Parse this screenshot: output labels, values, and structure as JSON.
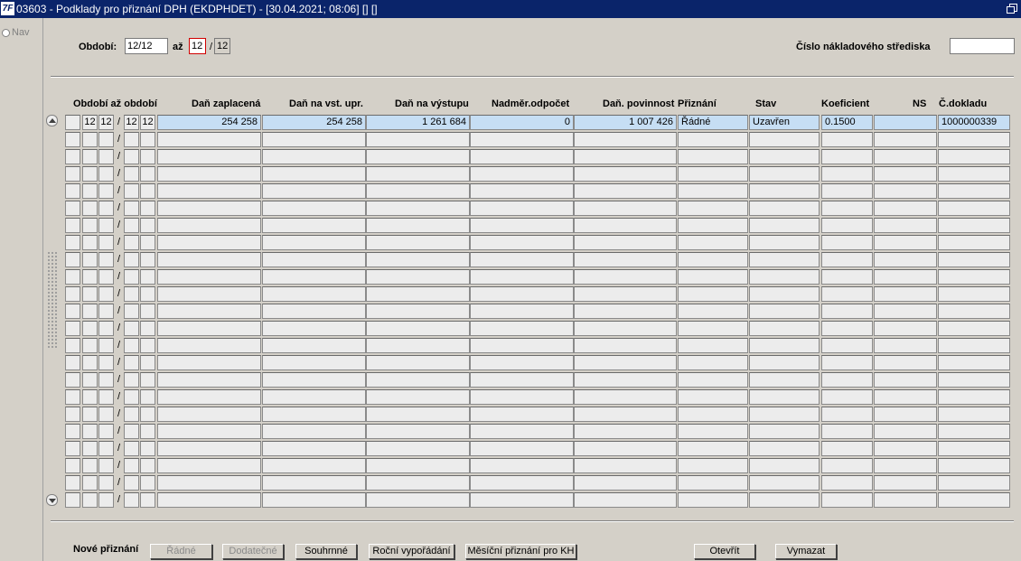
{
  "window": {
    "app_icon_text": "7F",
    "title": "03603 - Podklady pro přiznání DPH (EKDPHDET) - [30.04.2021; 08:06]  [] []"
  },
  "nav": {
    "label": "Nav"
  },
  "filters": {
    "obdobi_label": "Období:",
    "obdobi_from": "12/12",
    "az_label": "až",
    "obdobi_to_month": "12",
    "obdobi_to_sep": "/",
    "obdobi_to_year": "12",
    "cost_center_label": "Číslo nákladového střediska",
    "cost_center_value": ""
  },
  "table": {
    "headers": {
      "period": "Období až období",
      "paid": "Daň zaplacená",
      "input_adj": "Daň na vst. upr.",
      "output": "Daň na výstupu",
      "excess": "Nadměr.odpočet",
      "liability": "Daň. povinnost",
      "filing": "Přiznání",
      "status": "Stav",
      "coef": "Koeficient",
      "ns": "NS",
      "docno": "Č.dokladu"
    },
    "rows": [
      {
        "from_month": "12",
        "from_year": "12",
        "sep": "/",
        "to_month": "12",
        "to_year": "12",
        "paid": "254 258",
        "input_adj": "254 258",
        "output": "1 261 684",
        "excess": "0",
        "liability": "1 007 426",
        "filing": "Řádné",
        "status": "Uzavřen",
        "coef": "0.1500",
        "ns": "",
        "docno": "1000000339"
      }
    ],
    "empty_row_count": 22,
    "active_row_color": "#c6def4"
  },
  "footer": {
    "new_filing_label": "Nové přiznání",
    "buttons": {
      "radne": "Řádné",
      "dodatecne": "Dodatečné",
      "souhrnne": "Souhrnné",
      "rocni": "Roční vypořádání",
      "mesicni_kh": "Měsíční přiznání pro KH",
      "otevrit": "Otevřít",
      "vymazat": "Vymazat"
    }
  },
  "colors": {
    "titlebar": "#0a246a",
    "background": "#d4d0c8",
    "error_border": "#d00000"
  }
}
